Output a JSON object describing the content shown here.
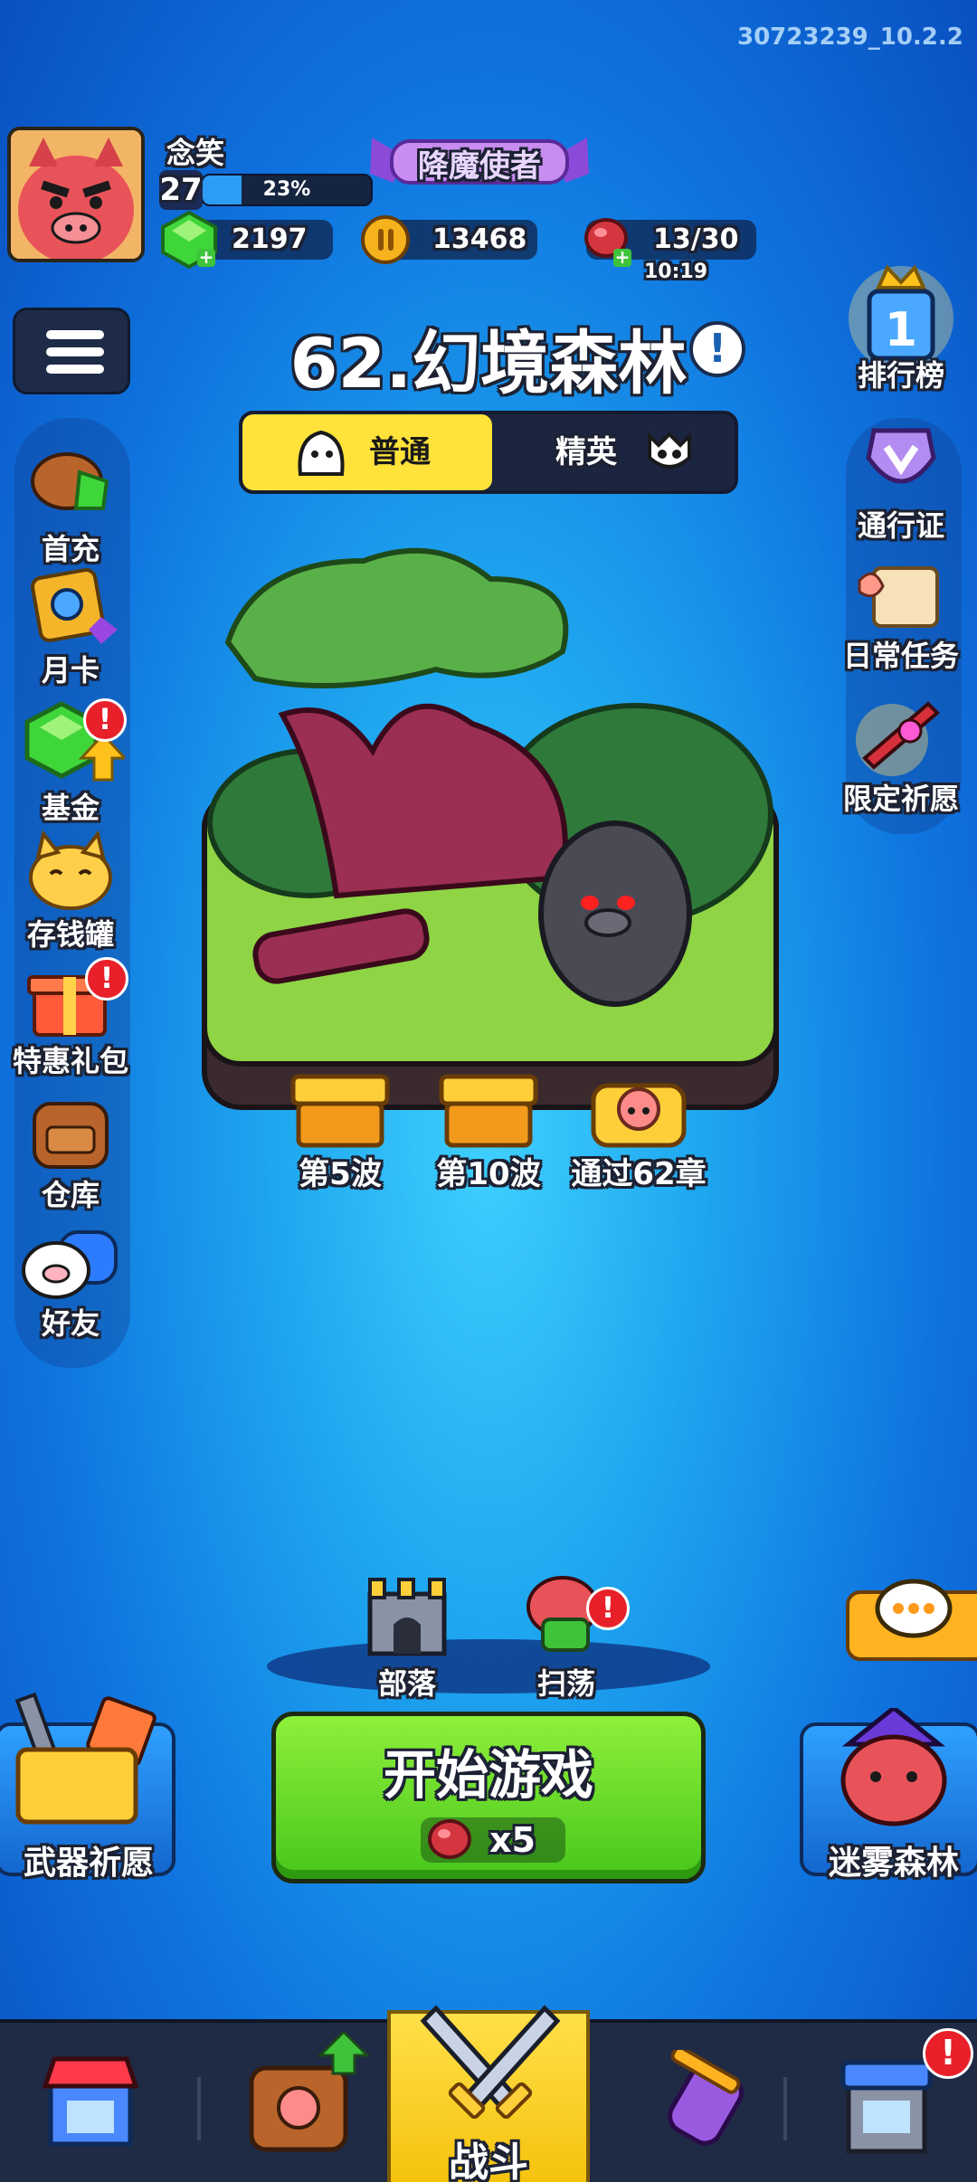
{
  "version": "30723239_10.2.2",
  "player": {
    "name": "念笑",
    "level": "27",
    "xp_percent_label": "23%",
    "xp_fraction": 0.23,
    "title_badge": "降魔使者"
  },
  "resources": {
    "gems": "2197",
    "coins": "13468",
    "energy": "13/30",
    "energy_timer": "10:19"
  },
  "stage": {
    "title": "62.幻境森林",
    "tabs": {
      "normal": "普通",
      "elite": "精英"
    }
  },
  "left_menu": [
    {
      "label": "首充",
      "alert": false
    },
    {
      "label": "月卡",
      "alert": false
    },
    {
      "label": "基金",
      "alert": true
    },
    {
      "label": "存钱罐",
      "alert": false
    },
    {
      "label": "特惠礼包",
      "alert": true
    },
    {
      "label": "仓库",
      "alert": false
    },
    {
      "label": "好友",
      "alert": false
    }
  ],
  "right_menu": [
    {
      "label": "排行榜"
    },
    {
      "label": "通行证"
    },
    {
      "label": "日常任务"
    },
    {
      "label": "限定祈愿"
    }
  ],
  "rewards": [
    {
      "label": "第5波"
    },
    {
      "label": "第10波"
    },
    {
      "label": "通过62章"
    }
  ],
  "actions": {
    "tribe": "部落",
    "sweep": "扫荡",
    "start_label": "开始游戏",
    "start_cost": "x5",
    "weapon_wish": "武器祈愿",
    "mist_forest": "迷雾森林"
  },
  "nav": {
    "battle": "战斗"
  },
  "colors": {
    "accent_yellow": "#ffe23a",
    "start_green": "#6bdc2a",
    "alert_red": "#e8202a",
    "nav_bg": "#1f2a45"
  }
}
